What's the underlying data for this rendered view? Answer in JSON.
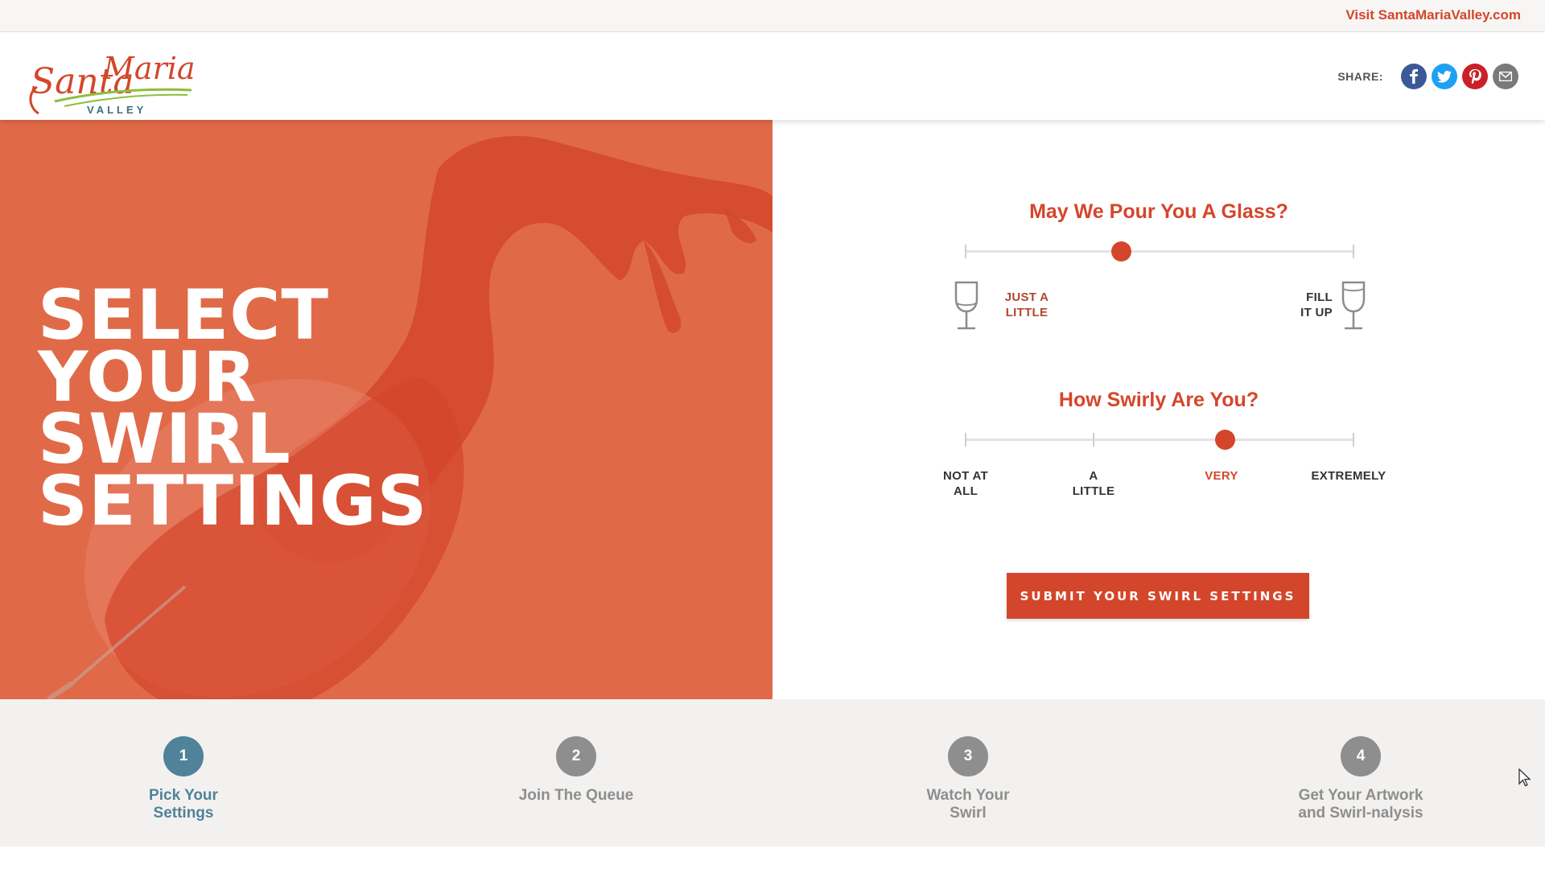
{
  "topbar": {
    "link_text": "Visit SantaMariaValley.com"
  },
  "header": {
    "logo": {
      "word1": "Santa",
      "word2": "Maria",
      "word3": "VALLEY"
    },
    "share_label": "SHARE:",
    "social_icons": [
      "facebook-icon",
      "twitter-icon",
      "pinterest-icon",
      "email-icon"
    ]
  },
  "hero": {
    "title_lines": [
      "SELECT",
      "YOUR",
      "SWIRL",
      "SETTINGS"
    ]
  },
  "pour": {
    "question": "May We Pour You A Glass?",
    "min_label_line1": "JUST A",
    "min_label_line2": "LITTLE",
    "max_label_line1": "FILL",
    "max_label_line2": "IT UP",
    "level": 0.4
  },
  "swirl": {
    "question": "How Swirly Are You?",
    "options": [
      {
        "line1": "NOT AT",
        "line2": "ALL"
      },
      {
        "line1": "A",
        "line2": "LITTLE"
      },
      {
        "line1": "VERY",
        "line2": ""
      },
      {
        "line1": "EXTREMELY",
        "line2": ""
      }
    ],
    "selected_index": 2
  },
  "submit_label": "SUBMIT YOUR SWIRL SETTINGS",
  "steps": [
    {
      "number": "1",
      "line1": "Pick Your",
      "line2": "Settings",
      "current": true
    },
    {
      "number": "2",
      "line1": "Join The Queue",
      "line2": "",
      "current": false
    },
    {
      "number": "3",
      "line1": "Watch Your",
      "line2": "Swirl",
      "current": false
    },
    {
      "number": "4",
      "line1": "Get Your Artwork",
      "line2": "and Swirl-nalysis",
      "current": false
    }
  ],
  "colors": {
    "accent": "#d4462b",
    "hero_bg": "#e06a48",
    "step_active": "#4f8399",
    "step_inactive": "#8e8e8e"
  }
}
